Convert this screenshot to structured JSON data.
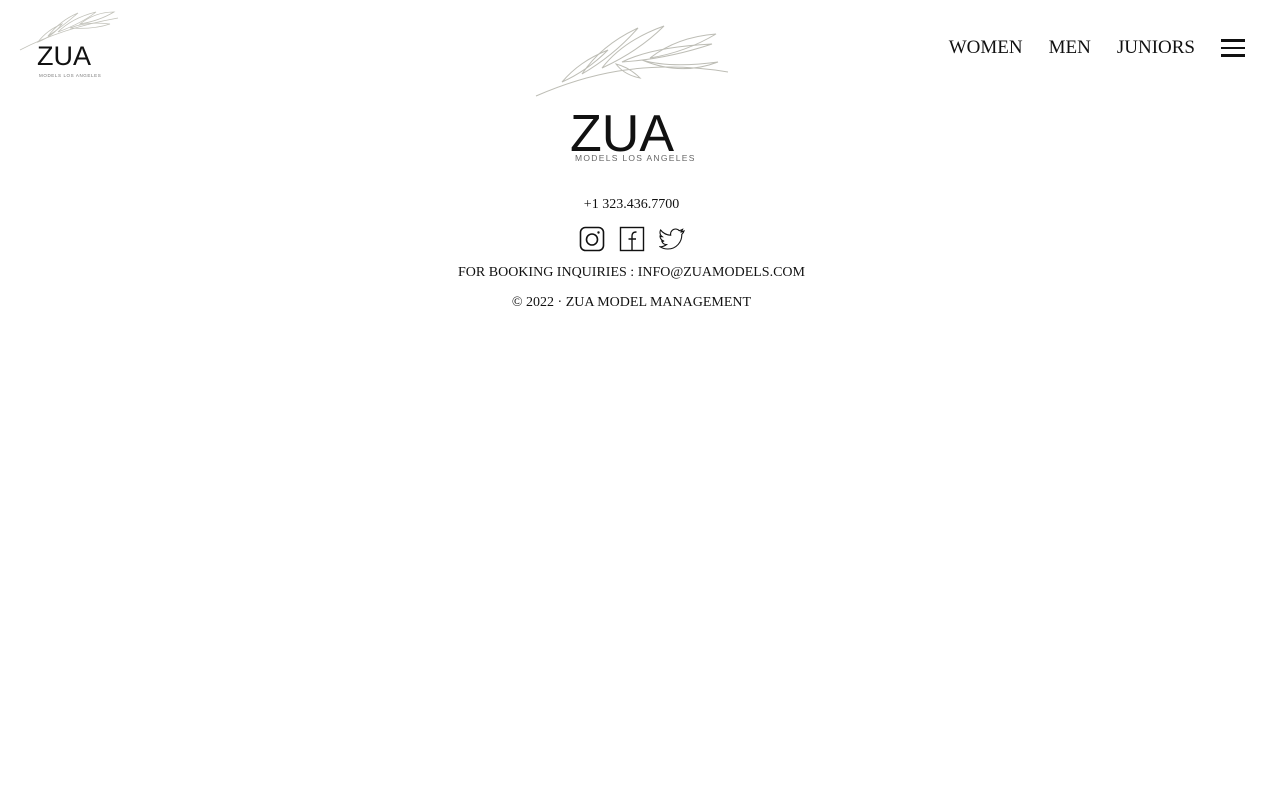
{
  "logo": {
    "wordmark": "ZUA",
    "tagline": "MODELS LOS ANGELES"
  },
  "nav": {
    "items": [
      {
        "label": "WOMEN"
      },
      {
        "label": "MEN"
      },
      {
        "label": "JUNIORS"
      }
    ],
    "menu_icon": "hamburger-icon"
  },
  "contact": {
    "phone": "+1 323.436.7700",
    "booking_label": "FOR BOOKING INQUIRIES :",
    "email": "INFO@ZUAMODELS.COM"
  },
  "socials": [
    {
      "icon": "instagram-icon"
    },
    {
      "icon": "facebook-icon"
    },
    {
      "icon": "twitter-icon"
    }
  ],
  "copyright": "© 2022 · ZUA MODEL MANAGEMENT",
  "colors": {
    "background": "#ffffff",
    "text": "#111111",
    "branch": "#bdbdb5"
  }
}
